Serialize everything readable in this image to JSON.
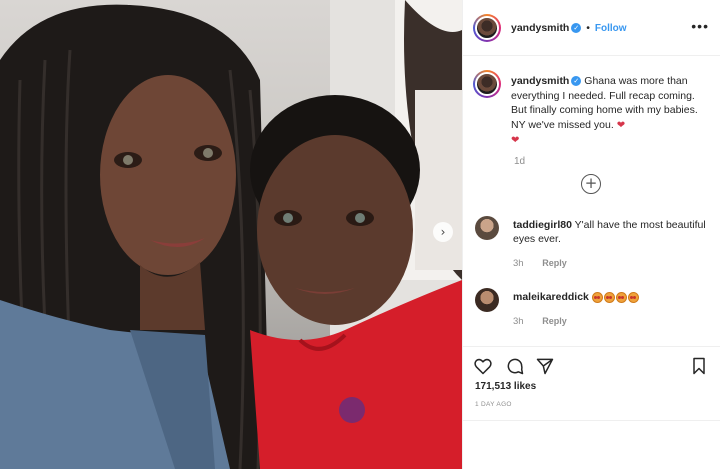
{
  "post": {
    "username": "yandysmith",
    "verified_mark": "✓",
    "dot": "•",
    "follow_label": "Follow",
    "more_label": "•••",
    "next_arrow": "›",
    "caption": {
      "username": "yandysmith",
      "text": "Ghana was more than everything I needed. Full recap coming. But finally coming home with my babies. NY we've missed you.",
      "heart": "❤",
      "time": "1d"
    },
    "load_more_label": "+",
    "comments": [
      {
        "username": "taddiegirl80",
        "text": "Y'all have the most beautiful eyes ever.",
        "time": "3h",
        "reply_label": "Reply"
      },
      {
        "username": "maleikareddick",
        "emoji_count": 4,
        "time": "3h",
        "reply_label": "Reply"
      }
    ],
    "likes": "171,513 likes",
    "age": "1 DAY AGO"
  },
  "icons": {
    "like": "heart-icon",
    "comment": "comment-icon",
    "share": "paper-plane-icon",
    "save": "bookmark-icon"
  },
  "colors": {
    "link_blue": "#3897f0",
    "text": "#262626",
    "muted": "#8e8e8e",
    "heart_red": "#d6364b"
  }
}
